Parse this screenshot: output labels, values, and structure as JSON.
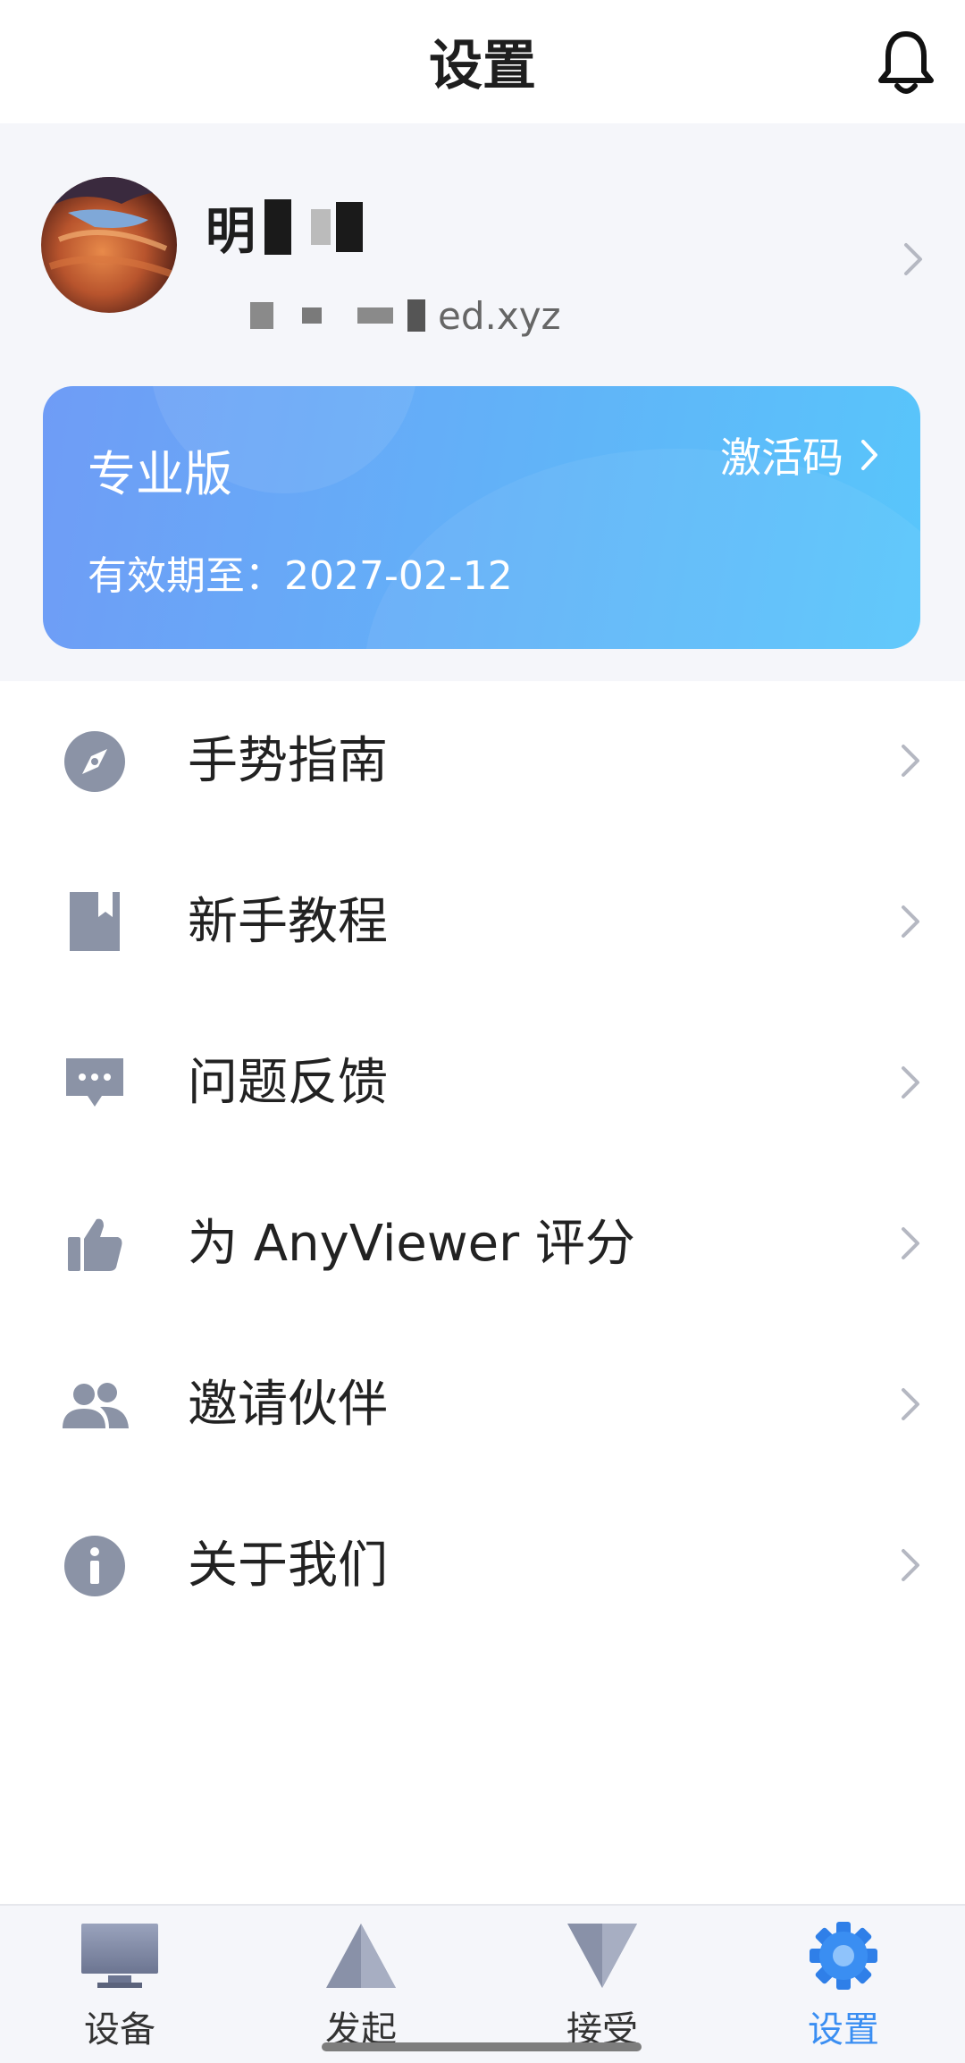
{
  "header": {
    "title": "设置",
    "bell_icon": "bell-icon"
  },
  "profile": {
    "name_visible": "明",
    "email_visible_suffix": "ed.xyz",
    "avatar_icon": "canyon-photo-avatar"
  },
  "license": {
    "edition": "专业版",
    "expiry": "有效期至：2027-02-12",
    "activation_label": "激活码"
  },
  "menu": {
    "items": [
      {
        "label": "手势指南",
        "icon": "compass-icon"
      },
      {
        "label": "新手教程",
        "icon": "book-icon"
      },
      {
        "label": "问题反馈",
        "icon": "feedback-icon"
      },
      {
        "label": "为 AnyViewer 评分",
        "icon": "thumbs-up-icon"
      },
      {
        "label": "邀请伙伴",
        "icon": "people-icon"
      },
      {
        "label": "关于我们",
        "icon": "info-icon"
      }
    ]
  },
  "tabbar": {
    "tabs": [
      {
        "label": "设备",
        "icon": "monitor-icon",
        "active": false
      },
      {
        "label": "发起",
        "icon": "triangle-up-icon",
        "active": false
      },
      {
        "label": "接受",
        "icon": "triangle-down-icon",
        "active": false
      },
      {
        "label": "设置",
        "icon": "gear-icon",
        "active": true
      }
    ]
  },
  "colors": {
    "accent": "#3a8ef2",
    "card_gradient_start": "#6f9cf6",
    "card_gradient_end": "#58c6fb",
    "icon_gray": "#8b93a6"
  }
}
